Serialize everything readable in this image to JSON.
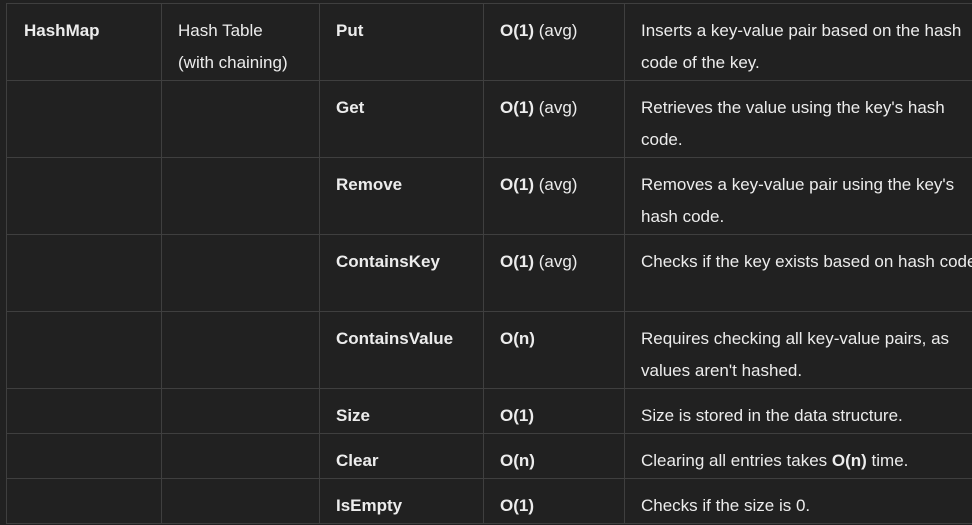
{
  "table": {
    "data_structure": "HashMap",
    "implementation": "Hash Table (with chaining)",
    "rows": [
      {
        "operation": "Put",
        "complexity": "O(1)",
        "complexity_note": " (avg)",
        "description": "Inserts a key-value pair based on the hash code of the key."
      },
      {
        "operation": "Get",
        "complexity": "O(1)",
        "complexity_note": " (avg)",
        "description": "Retrieves the value using the key's hash code."
      },
      {
        "operation": "Remove",
        "complexity": "O(1)",
        "complexity_note": " (avg)",
        "description": "Removes a key-value pair using the key's hash code."
      },
      {
        "operation": "ContainsKey",
        "complexity": "O(1)",
        "complexity_note": " (avg)",
        "description": "Checks if the key exists based on hash code."
      },
      {
        "operation": "ContainsValue",
        "complexity": "O(n)",
        "complexity_note": "",
        "description": "Requires checking all key-value pairs, as values aren't hashed."
      },
      {
        "operation": "Size",
        "complexity": "O(1)",
        "complexity_note": "",
        "description": "Size is stored in the data structure."
      },
      {
        "operation": "Clear",
        "complexity": "O(n)",
        "complexity_note": "",
        "description_pre": "Clearing all entries takes ",
        "description_bold": "O(n)",
        "description_post": " time."
      },
      {
        "operation": "IsEmpty",
        "complexity": "O(1)",
        "complexity_note": "",
        "description": "Checks if the size is 0."
      }
    ]
  }
}
